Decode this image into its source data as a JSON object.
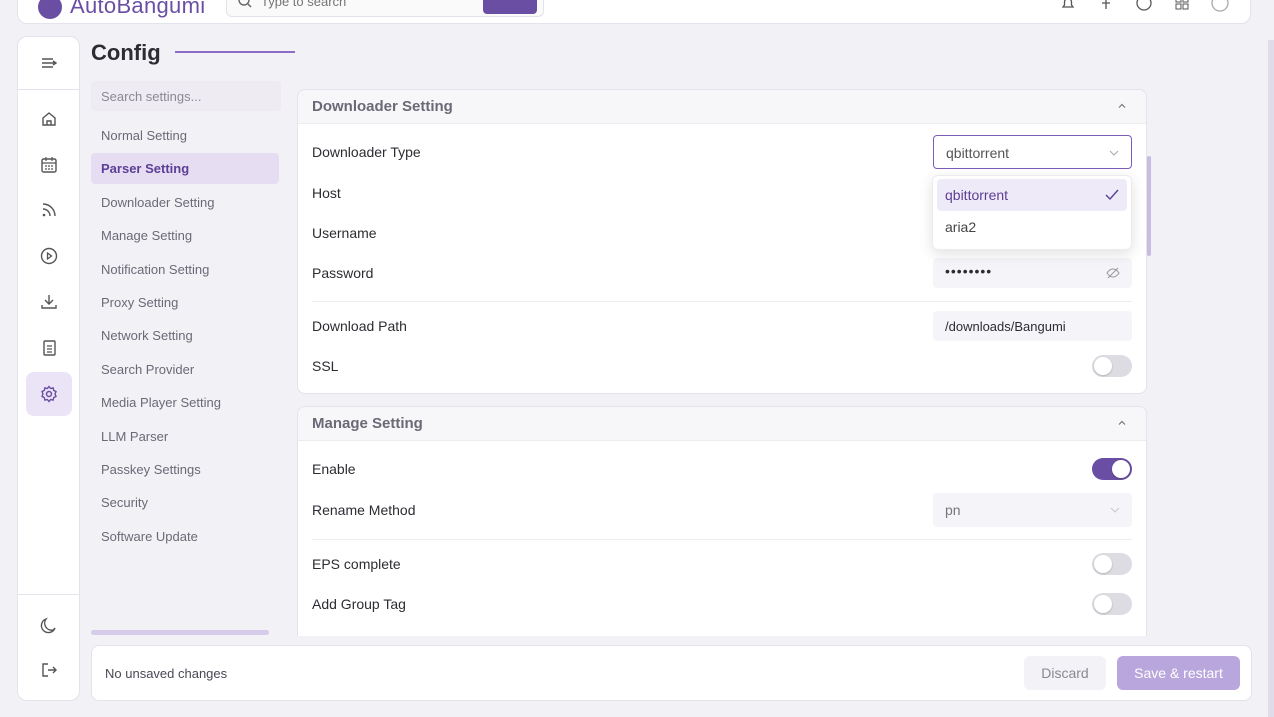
{
  "app": {
    "name": "AutoBangumi",
    "search_placeholder": "Type to search"
  },
  "page": {
    "title": "Config",
    "settings_search_placeholder": "Search settings..."
  },
  "settings_nav": [
    {
      "label": "Normal Setting",
      "active": false
    },
    {
      "label": "Parser Setting",
      "active": true
    },
    {
      "label": "Downloader Setting",
      "active": false
    },
    {
      "label": "Manage Setting",
      "active": false
    },
    {
      "label": "Notification Setting",
      "active": false
    },
    {
      "label": "Proxy Setting",
      "active": false
    },
    {
      "label": "Network Setting",
      "active": false
    },
    {
      "label": "Search Provider",
      "active": false
    },
    {
      "label": "Media Player Setting",
      "active": false
    },
    {
      "label": "LLM Parser",
      "active": false
    },
    {
      "label": "Passkey Settings",
      "active": false
    },
    {
      "label": "Security",
      "active": false
    },
    {
      "label": "Software Update",
      "active": false
    }
  ],
  "downloader": {
    "title": "Downloader Setting",
    "type_label": "Downloader Type",
    "type_value": "qbittorrent",
    "host_label": "Host",
    "username_label": "Username",
    "password_label": "Password",
    "password_value": "••••••••",
    "path_label": "Download Path",
    "path_value": "/downloads/Bangumi",
    "ssl_label": "SSL",
    "ssl_on": false,
    "options": [
      {
        "label": "qbittorrent",
        "selected": true
      },
      {
        "label": "aria2",
        "selected": false
      }
    ]
  },
  "manage": {
    "title": "Manage Setting",
    "enable_label": "Enable",
    "enable_on": true,
    "rename_label": "Rename Method",
    "rename_value": "pn",
    "eps_label": "EPS complete",
    "eps_on": false,
    "group_tag_label": "Add Group Tag",
    "group_tag_on": false
  },
  "footer": {
    "status": "No unsaved changes",
    "discard_label": "Discard",
    "save_label": "Save & restart"
  },
  "colors": {
    "accent": "#6a4ea3",
    "accent_light": "#e6ddf3",
    "save_disabled": "#b9a6dc"
  },
  "icons": [
    "menu-icon",
    "home-icon",
    "calendar-icon",
    "rss-icon",
    "play-icon",
    "download-icon",
    "log-icon",
    "settings-icon",
    "moon-icon",
    "logout-icon"
  ]
}
